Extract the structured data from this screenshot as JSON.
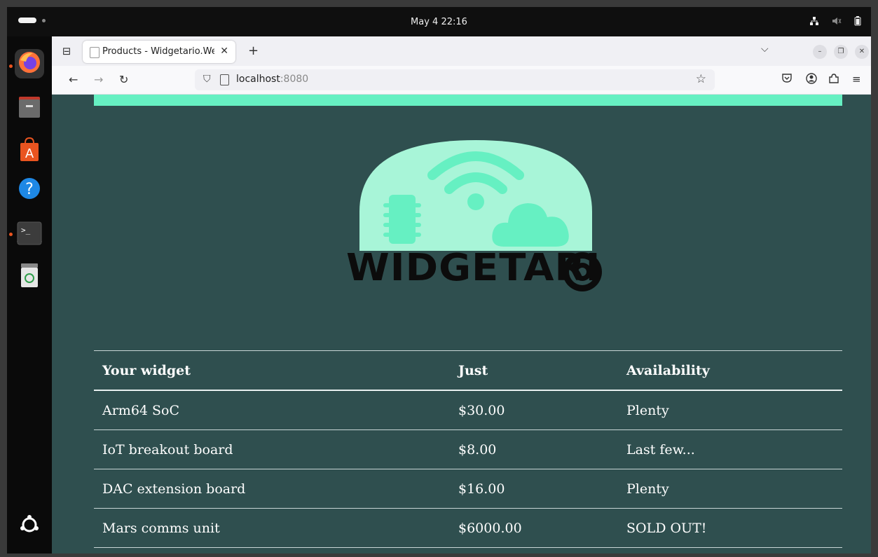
{
  "system": {
    "clock": "May 4  22:16"
  },
  "browser": {
    "tab_title": "Products - Widgetario.We",
    "url_host": "localhost",
    "url_port": ":8080"
  },
  "logo": {
    "text": "WIDGETARI"
  },
  "table": {
    "headers": [
      "Your widget",
      "Just",
      "Availability"
    ],
    "rows": [
      [
        "Arm64 SoC",
        "$30.00",
        "Plenty"
      ],
      [
        "IoT breakout board",
        "$8.00",
        "Last few..."
      ],
      [
        "DAC extension board",
        "$16.00",
        "Plenty"
      ],
      [
        "Mars comms unit",
        "$6000.00",
        "SOLD OUT!"
      ]
    ]
  },
  "colors": {
    "page_background": "#2f4f4f",
    "accent": "#66f0c2",
    "logo_fill": "#a8f5d8"
  }
}
